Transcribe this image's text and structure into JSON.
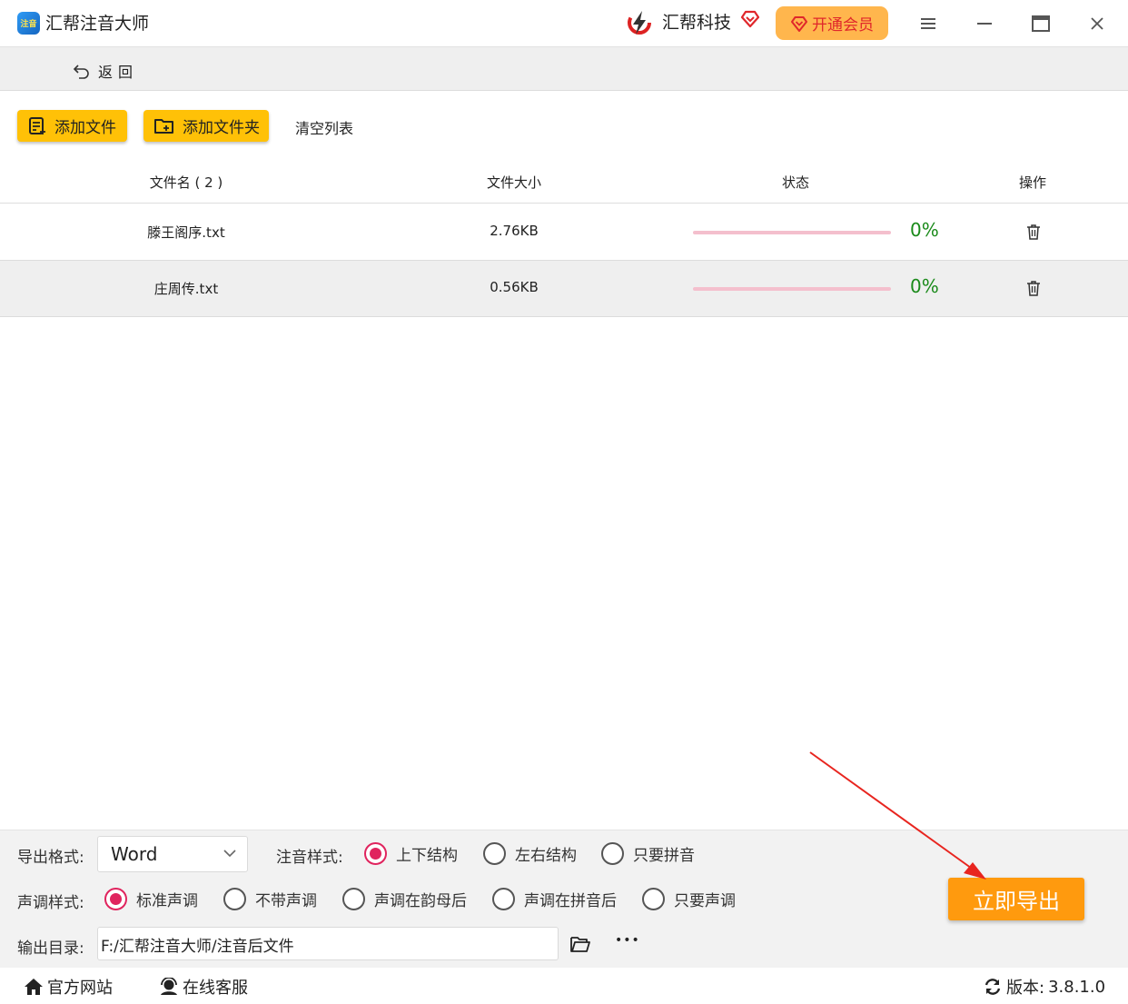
{
  "titlebar": {
    "app_title": "汇帮注音大师",
    "logo_text": "注音",
    "brand_name": "汇帮科技",
    "vip_label": "开通会员",
    "icons": [
      "app-logo",
      "brand-lightning-logo",
      "heart-diamond-icon",
      "menu-icon",
      "minimize-icon",
      "maximize-icon",
      "close-icon"
    ]
  },
  "nav": {
    "back_label": "返回"
  },
  "toolbar": {
    "add_file_label": "添加文件",
    "add_folder_label": "添加文件夹",
    "clear_label": "清空列表"
  },
  "table": {
    "headers": {
      "filename": "文件名 ( 2 )",
      "size": "文件大小",
      "status": "状态",
      "action": "操作"
    },
    "rows": [
      {
        "name": "滕王阁序.txt",
        "size": "2.76KB",
        "progress": 0,
        "percent": "0%"
      },
      {
        "name": "庄周传.txt",
        "size": "0.56KB",
        "progress": 0,
        "percent": "0%"
      }
    ]
  },
  "settings": {
    "format_label": "导出格式:",
    "format_value": "Word",
    "style_label": "注音样式:",
    "style_options": [
      "上下结构",
      "左右结构",
      "只要拼音"
    ],
    "style_selected": "上下结构",
    "tone_label": "声调样式:",
    "tone_options": [
      "标准声调",
      "不带声调",
      "声调在韵母后",
      "声调在拼音后",
      "只要声调"
    ],
    "tone_selected": "标准声调",
    "output_label": "输出目录:",
    "output_path": "F:/汇帮注音大师/注音后文件",
    "more_label": "•••",
    "export_label": "立即导出"
  },
  "footer": {
    "website_label": "官方网站",
    "support_label": "在线客服",
    "version_label": "版本:",
    "version_value": "3.8.1.0"
  },
  "colors": {
    "accent_yellow": "#ffc107",
    "export_orange": "#ff9a0e",
    "radio_pink": "#e0245e",
    "percent_green": "#1a8a1a",
    "progress_track": "#f4bfcd",
    "annotation_red": "#e8251f"
  }
}
